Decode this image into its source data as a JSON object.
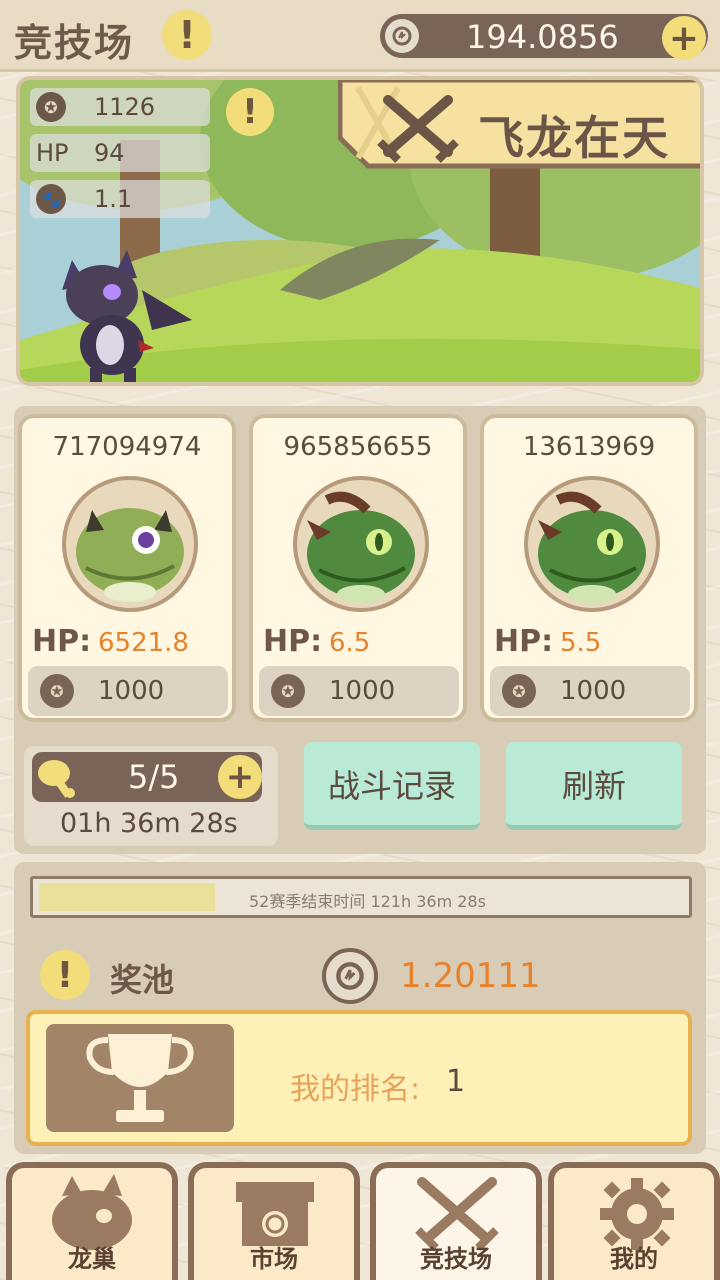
{
  "header": {
    "title": "竞技场",
    "balance": "194.0856"
  },
  "player": {
    "rank_score": "1126",
    "hp_label": "HP",
    "hp": "94",
    "paw_stat": "1.1",
    "banner": "飞龙在天"
  },
  "opponents": [
    {
      "id": "717094974",
      "hp_label": "HP:",
      "hp": "6521.8",
      "rank": "1000",
      "color": "#8fae55"
    },
    {
      "id": "965856655",
      "hp_label": "HP:",
      "hp": "6.5",
      "rank": "1000",
      "color": "#4f8a3e"
    },
    {
      "id": "13613969",
      "hp_label": "HP:",
      "hp": "5.5",
      "rank": "1000",
      "color": "#4f8a3e"
    }
  ],
  "energy": {
    "count": "5/5",
    "timer": "01h 36m 28s"
  },
  "buttons": {
    "battle_log": "战斗记录",
    "refresh": "刷新"
  },
  "season": {
    "progress": 0.27,
    "text": "52赛季结束时间 121h 36m 28s"
  },
  "pool": {
    "label": "奖池",
    "value": "1.20111"
  },
  "ranking": {
    "label": "我的排名:",
    "value": "1"
  },
  "nav": [
    {
      "label": "龙巢",
      "icon": "dragon-head-icon"
    },
    {
      "label": "市场",
      "icon": "shop-icon"
    },
    {
      "label": "竞技场",
      "icon": "crossed-swords-icon",
      "active": true
    },
    {
      "label": "我的",
      "icon": "gear-icon"
    }
  ],
  "colors": {
    "accent": "#e7822c",
    "brown": "#7a6458",
    "mint": "#b9ead6",
    "yellow": "#f3dc7a"
  }
}
